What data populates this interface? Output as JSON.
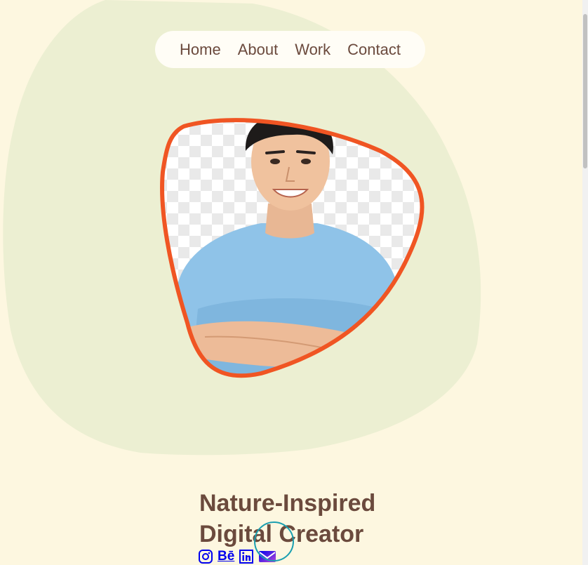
{
  "nav": {
    "items": [
      {
        "label": "Home"
      },
      {
        "label": "About"
      },
      {
        "label": "Work"
      },
      {
        "label": "Contact"
      }
    ]
  },
  "hero": {
    "title_line1": "Nature-Inspired",
    "title_line2": "Digital Creator",
    "portrait_alt": "Portrait"
  },
  "socials": [
    {
      "name": "instagram-icon"
    },
    {
      "name": "behance-icon",
      "label": "Bē"
    },
    {
      "name": "linkedin-icon"
    },
    {
      "name": "email-icon"
    }
  ],
  "colors": {
    "page_bg": "#fdf7e0",
    "blob": "#ecefd2",
    "text_brown": "#6b4a3d",
    "portrait_border": "#f05523",
    "link_blue": "#0000ee",
    "cursor_ring": "#1a9fb0"
  }
}
